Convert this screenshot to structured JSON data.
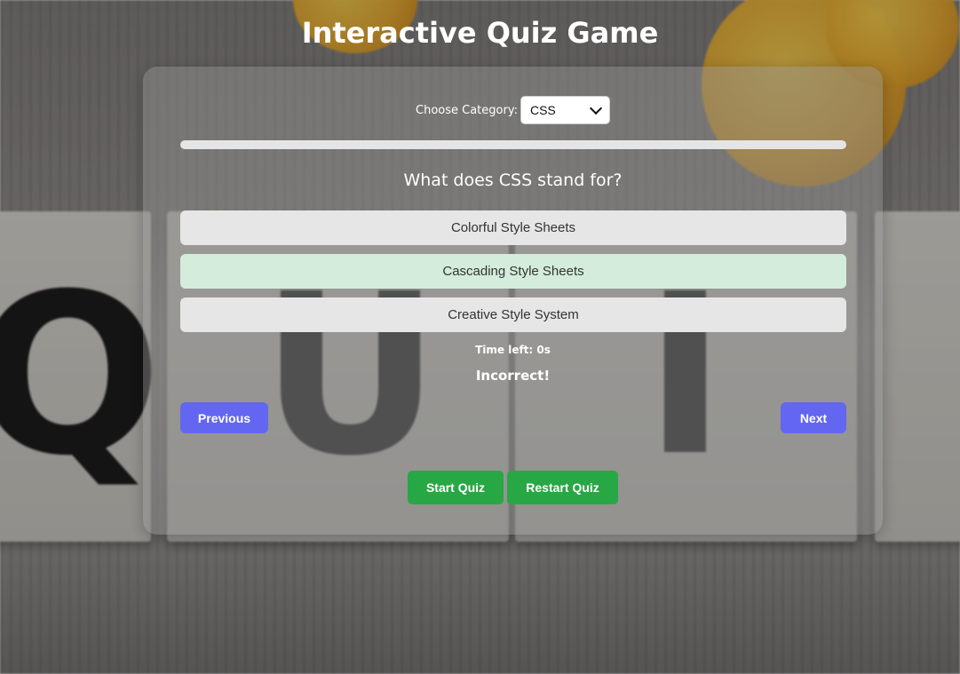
{
  "title": "Interactive Quiz Game",
  "category": {
    "label": "Choose Category:",
    "selected": "CSS"
  },
  "progress": {
    "fraction": 1.0
  },
  "question": {
    "text": "What does CSS stand for?",
    "options": [
      {
        "label": "Colorful Style Sheets",
        "state": "default"
      },
      {
        "label": "Cascading Style Sheets",
        "state": "correct"
      },
      {
        "label": "Creative Style System",
        "state": "default"
      }
    ]
  },
  "timer": "Time left: 0s",
  "feedback": "Incorrect!",
  "nav": {
    "previous": "Previous",
    "next": "Next"
  },
  "actions": {
    "start": "Start Quiz",
    "restart": "Restart Quiz"
  },
  "colors": {
    "nav_button": "#6366f1",
    "action_button": "#28a745",
    "correct_option": "#d4ecdb",
    "default_option": "#e6e6e6"
  }
}
